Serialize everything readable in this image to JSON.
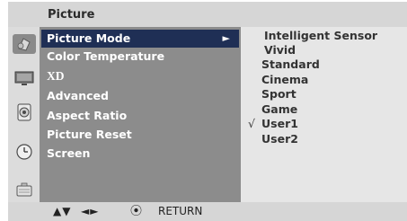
{
  "header": {
    "title": "Picture"
  },
  "sidebar": {
    "icons": [
      {
        "name": "picture-icon"
      },
      {
        "name": "tv-screen-icon"
      },
      {
        "name": "audio-speaker-icon"
      },
      {
        "name": "clock-icon"
      },
      {
        "name": "option-icon"
      }
    ]
  },
  "menu": {
    "items": [
      {
        "label": "Picture Mode",
        "selected": true,
        "arrow": "►"
      },
      {
        "label": "Color Temperature"
      },
      {
        "label": "XD"
      },
      {
        "label": "Advanced"
      },
      {
        "label": "Aspect Ratio"
      },
      {
        "label": "Picture Reset"
      },
      {
        "label": "Screen"
      }
    ]
  },
  "options": {
    "items": [
      {
        "label": "Intelligent Sensor"
      },
      {
        "label": "Vivid"
      },
      {
        "label": "Standard"
      },
      {
        "label": "Cinema"
      },
      {
        "label": "Sport"
      },
      {
        "label": "Game"
      },
      {
        "label": "User1",
        "checked": true,
        "check": "√"
      },
      {
        "label": "User2"
      }
    ]
  },
  "footer": {
    "nav_updown": "▲▼",
    "nav_leftright": "◄►",
    "ok_symbol": "⦿",
    "return_label": "RETURN"
  },
  "colors": {
    "selected_bg": "#1f2f55",
    "menu_bg": "#8c8c8c",
    "options_bg": "#e6e6e6",
    "frame_bg": "#d6d6d6"
  }
}
